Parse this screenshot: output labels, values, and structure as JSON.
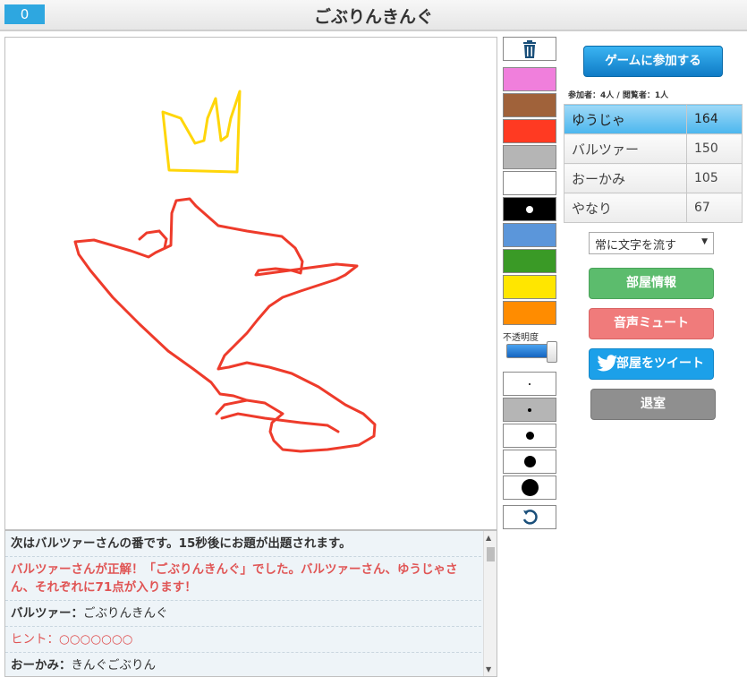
{
  "header": {
    "counter": "0",
    "title": "ごぶりんきんぐ"
  },
  "tools": {
    "trash_icon": "trash-icon",
    "swatches": [
      {
        "color": "#f07fdc"
      },
      {
        "color": "#a0623a"
      },
      {
        "color": "#ff3a22"
      },
      {
        "color": "#b5b5b5"
      },
      {
        "color": "#ffffff"
      },
      {
        "color": "#000000"
      },
      {
        "color": "#5b96da"
      },
      {
        "color": "#3a9a26"
      },
      {
        "color": "#ffe600"
      },
      {
        "color": "#ff8c00"
      }
    ],
    "opacity_label": "不透明度",
    "undo_icon": "undo-icon"
  },
  "right": {
    "join_label": "ゲームに参加する",
    "counts_text": "参加者：4人 / 閲覧者：1人",
    "players": [
      {
        "name": "ゆうじゃ",
        "score": "164"
      },
      {
        "name": "バルツァー",
        "score": "150"
      },
      {
        "name": "おーかみ",
        "score": "105"
      },
      {
        "name": "やなり",
        "score": "67"
      }
    ],
    "select_value": "常に文字を流す",
    "info_label": "部屋情報",
    "mute_label": "音声ミュート",
    "tweet_label": "部屋をツイート",
    "exit_label": "退室"
  },
  "chat": {
    "messages": [
      {
        "type": "system",
        "text": "次はバルツァーさんの番です。15秒後にお題が出題されます。"
      },
      {
        "type": "correct",
        "text": "バルツァーさんが正解！「ごぶりんきんぐ」でした。バルツァーさん、ゆうじゃさん、それぞれに71点が入ります！"
      },
      {
        "type": "user",
        "name": "バルツァー",
        "text": "ごぶりんきんぐ"
      },
      {
        "type": "hint",
        "name": "ヒント",
        "text": "○○○○○○○"
      },
      {
        "type": "user",
        "name": "おーかみ",
        "text": "きんぐごぶりん"
      }
    ]
  }
}
